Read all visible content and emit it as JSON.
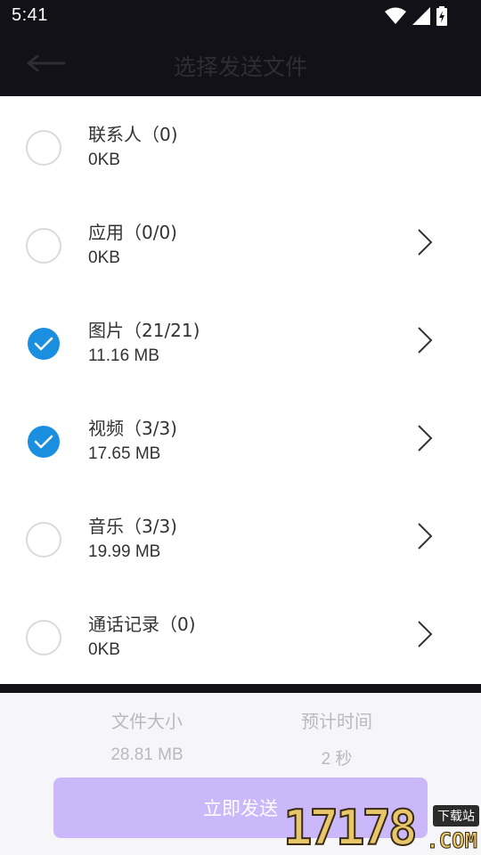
{
  "status_bar": {
    "time": "5:41",
    "icons": [
      "wifi-icon",
      "signal-icon",
      "battery-charging-icon"
    ]
  },
  "app_bar": {
    "title": "选择发送文件",
    "back_icon": "back-arrow-icon"
  },
  "items": [
    {
      "title": "联系人（0)",
      "size": "0KB",
      "checked": false,
      "has_chevron": false
    },
    {
      "title": "应用（0/0)",
      "size": "0KB",
      "checked": false,
      "has_chevron": true
    },
    {
      "title": "图片（21/21)",
      "size": "11.16 MB",
      "checked": true,
      "has_chevron": true
    },
    {
      "title": "视频（3/3)",
      "size": "17.65 MB",
      "checked": true,
      "has_chevron": true
    },
    {
      "title": "音乐（3/3)",
      "size": "19.99 MB",
      "checked": false,
      "has_chevron": true
    },
    {
      "title": "通话记录（0)",
      "size": "0KB",
      "checked": false,
      "has_chevron": true
    }
  ],
  "summary": {
    "size_label": "文件大小",
    "size_value": "28.81 MB",
    "time_label": "预计时间",
    "time_value": "2 秒"
  },
  "send_button": {
    "label": "立即发送"
  },
  "watermark": {
    "digits": "17178",
    "suffix": ".COM",
    "tag": "下载站"
  },
  "colors": {
    "accent": "#1a8fe0",
    "button": "#cbb8fb",
    "header": "#131118"
  }
}
